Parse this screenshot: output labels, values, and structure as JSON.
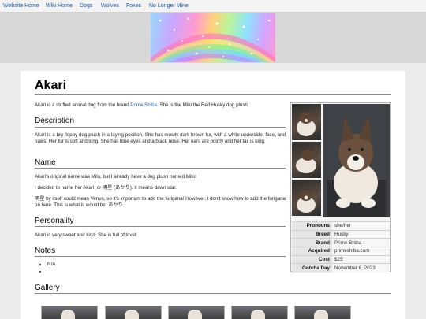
{
  "nav": {
    "links": [
      "Website Home",
      "Wiki Home",
      "Dogs",
      "Wolves",
      "Foxes",
      "No Longer Mine"
    ]
  },
  "title": "Akari",
  "intro": {
    "before": "Akari is a stuffed animal dog from the brand ",
    "link": "Prime Shiba",
    "after": ". She is the Milo the Red Husky dog plush."
  },
  "sections": {
    "description": {
      "heading": "Description",
      "text": "Akari is a big floppy dog plush in a laying position. She has mostly dark brown fur, with a white underside, face, and paws. Her fur is soft and long. She has blue eyes and a black nose. Her ears are pointy and her tail is long."
    },
    "name": {
      "heading": "Name",
      "p1": "Akari's original name was Milo, but I already have a dog plush named Milo!",
      "p2": "I decided to name her Akari, or 明星 (あかり). It means dawn star.",
      "p3": "明星 by itself could mean Venus, so it's important to add the furigana! However, I don't know how to add the furigana on here. This is what is would be: あかり."
    },
    "personality": {
      "heading": "Personality",
      "text": "Akari is very sweet and kind. She is full of love!"
    },
    "notes": {
      "heading": "Notes",
      "items": [
        "N/A",
        ""
      ]
    },
    "gallery": {
      "heading": "Gallery"
    }
  },
  "infobox": {
    "rows": [
      {
        "key": "Pronouns",
        "value": "she/her"
      },
      {
        "key": "Breed",
        "value": "Husky"
      },
      {
        "key": "Brand",
        "value": "Prime Shiba"
      },
      {
        "key": "Acquired",
        "value": "primeshiba.com"
      },
      {
        "key": "Cost",
        "value": "$25"
      },
      {
        "key": "Gotcha Day",
        "value": "November 6, 2023"
      }
    ]
  },
  "colors": {
    "link": "#1a5fb4",
    "background": "#ececec",
    "content": "#ffffff"
  }
}
